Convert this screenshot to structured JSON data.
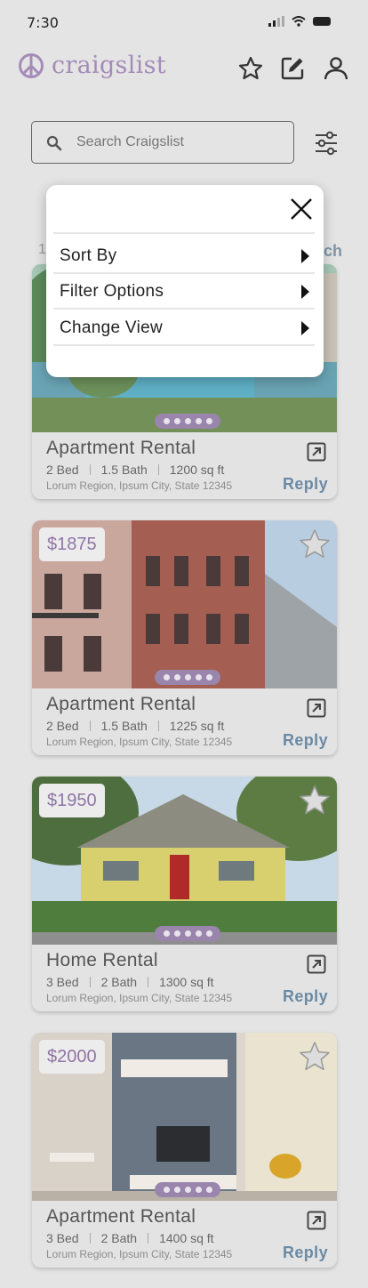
{
  "status_bar": {
    "time": "7:30"
  },
  "header": {
    "app_name": "craigslist",
    "brand_color": "#a58bb8"
  },
  "search": {
    "placeholder": "Search Craigslist",
    "value": ""
  },
  "behind_overlay": {
    "left_text": "1,",
    "right_text": "ch"
  },
  "menu": {
    "items": [
      {
        "label": "Sort By"
      },
      {
        "label": "Filter Options"
      },
      {
        "label": "Change View"
      }
    ]
  },
  "listings": [
    {
      "price": "",
      "title": "Apartment Rental",
      "beds": "2 Bed",
      "baths": "1.5 Bath",
      "area": "1200 sq ft",
      "address": "Lorum Region, Ipsum City, State 12345",
      "reply_label": "Reply",
      "photo_icon": "pool-photo"
    },
    {
      "price": "$1875",
      "title": "Apartment Rental",
      "beds": "2 Bed",
      "baths": "1.5 Bath",
      "area": "1225 sq ft",
      "address": "Lorum Region, Ipsum City, State 12345",
      "reply_label": "Reply",
      "photo_icon": "brick-apartment-photo"
    },
    {
      "price": "$1950",
      "title": "Home Rental",
      "beds": "3 Bed",
      "baths": "2 Bath",
      "area": "1300 sq ft",
      "address": "Lorum Region, Ipsum City, State 12345",
      "reply_label": "Reply",
      "photo_icon": "yellow-house-photo"
    },
    {
      "price": "$2000",
      "title": "Apartment Rental",
      "beds": "3 Bed",
      "baths": "2 Bath",
      "area": "1400 sq ft",
      "address": "Lorum Region, Ipsum City, State 12345",
      "reply_label": "Reply",
      "photo_icon": "living-room-photo"
    }
  ]
}
